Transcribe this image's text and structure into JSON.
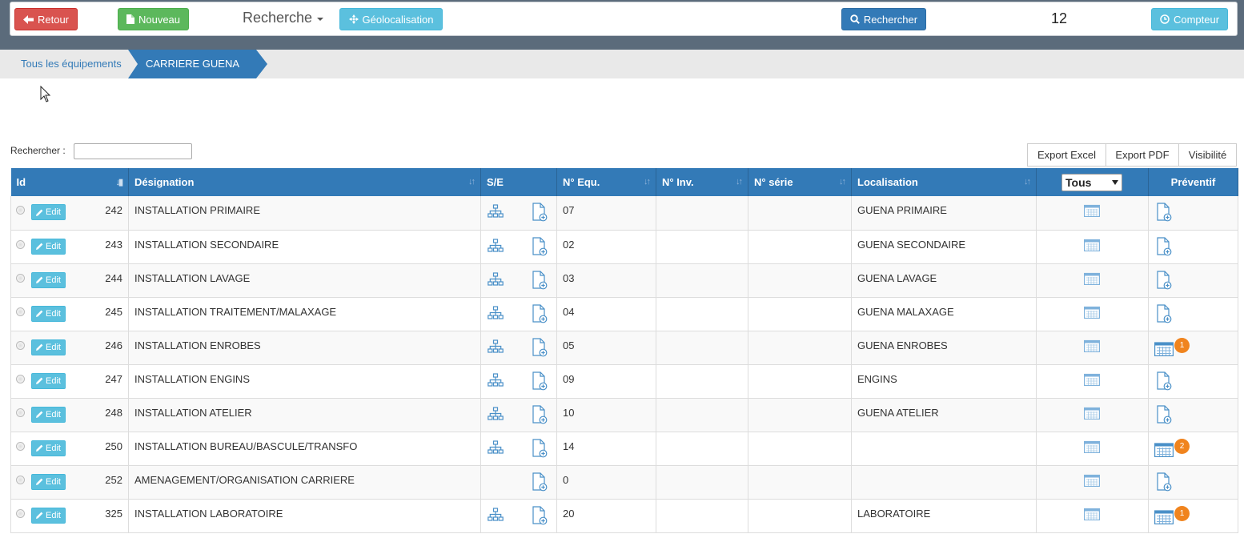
{
  "toolbar": {
    "back_label": "Retour",
    "new_label": "Nouveau",
    "search_menu_label": "Recherche",
    "geo_label": "Géolocalisation",
    "search_button_label": "Rechercher",
    "count": "12",
    "counter_label": "Compteur"
  },
  "breadcrumb": {
    "all_label": "Tous les équipements",
    "current_label": "CARRIERE GUENA"
  },
  "search": {
    "label": "Rechercher :",
    "value": ""
  },
  "export": {
    "excel": "Export Excel",
    "pdf": "Export PDF",
    "visibility": "Visibilité"
  },
  "table": {
    "headers": {
      "id": "Id",
      "designation": "Désignation",
      "se": "S/E",
      "n_equ": "N° Equ.",
      "n_inv": "N° Inv.",
      "n_serie": "N° série",
      "localisation": "Localisation",
      "filter": "Tous",
      "preventif": "Préventif"
    },
    "edit_label": "Edit",
    "rows": [
      {
        "id": "242",
        "designation": "INSTALLATION PRIMAIRE",
        "n_equ": "07",
        "localisation": "GUENA PRIMAIRE",
        "has_tree": true,
        "preventif": "doc",
        "badge": ""
      },
      {
        "id": "243",
        "designation": "INSTALLATION SECONDAIRE",
        "n_equ": "02",
        "localisation": "GUENA SECONDAIRE",
        "has_tree": true,
        "preventif": "doc",
        "badge": ""
      },
      {
        "id": "244",
        "designation": "INSTALLATION LAVAGE",
        "n_equ": "03",
        "localisation": "GUENA LAVAGE",
        "has_tree": true,
        "preventif": "doc",
        "badge": ""
      },
      {
        "id": "245",
        "designation": "INSTALLATION TRAITEMENT/MALAXAGE",
        "n_equ": "04",
        "localisation": "GUENA MALAXAGE",
        "has_tree": true,
        "preventif": "doc",
        "badge": ""
      },
      {
        "id": "246",
        "designation": "INSTALLATION ENROBES",
        "n_equ": "05",
        "localisation": "GUENA ENROBES",
        "has_tree": true,
        "preventif": "calendar",
        "badge": "1"
      },
      {
        "id": "247",
        "designation": "INSTALLATION ENGINS",
        "n_equ": "09",
        "localisation": "ENGINS",
        "has_tree": true,
        "preventif": "doc",
        "badge": ""
      },
      {
        "id": "248",
        "designation": "INSTALLATION ATELIER",
        "n_equ": "10",
        "localisation": "GUENA ATELIER",
        "has_tree": true,
        "preventif": "doc",
        "badge": ""
      },
      {
        "id": "250",
        "designation": "INSTALLATION BUREAU/BASCULE/TRANSFO",
        "n_equ": "14",
        "localisation": "",
        "has_tree": true,
        "preventif": "calendar",
        "badge": "2"
      },
      {
        "id": "252",
        "designation": "AMENAGEMENT/ORGANISATION CARRIERE",
        "n_equ": "0",
        "localisation": "",
        "has_tree": false,
        "preventif": "doc",
        "badge": ""
      },
      {
        "id": "325",
        "designation": "INSTALLATION LABORATOIRE",
        "n_equ": "20",
        "localisation": "LABORATOIRE",
        "has_tree": true,
        "preventif": "calendar",
        "badge": "1"
      }
    ]
  },
  "colors": {
    "danger": "#d9534f",
    "success": "#5cb85c",
    "info": "#5bc0de",
    "primary": "#337ab7",
    "badge": "#f0841e"
  }
}
